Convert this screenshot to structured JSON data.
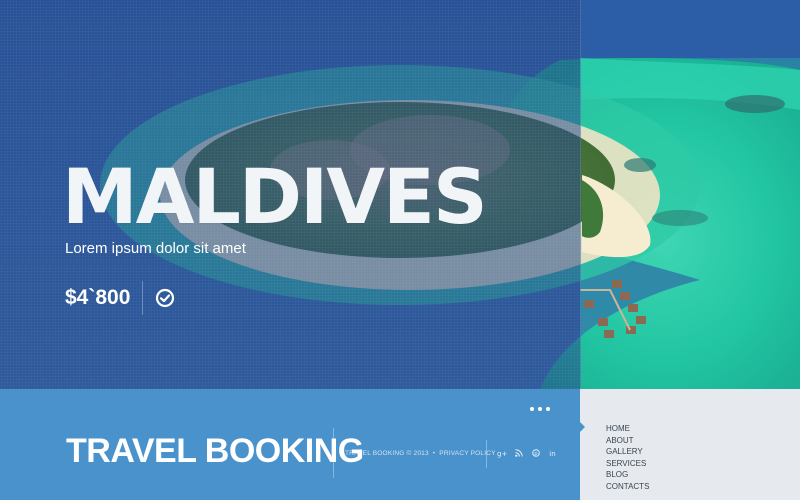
{
  "hero": {
    "title": "MALDIVES",
    "subtitle": "Lorem ipsum dolor sit amet",
    "price": "$4`800"
  },
  "footer": {
    "brand": "TRAVEL BOOKING",
    "copyright_prefix": "TRAVEL BOOKING © 2013",
    "copyright_sep": "•",
    "privacy_label": "PRIVACY POLICY",
    "social": [
      {
        "name": "google-plus-icon",
        "glyph": "g+"
      },
      {
        "name": "rss-icon",
        "glyph": "❡"
      },
      {
        "name": "pinterest-icon",
        "glyph": "℗"
      },
      {
        "name": "linkedin-icon",
        "glyph": "in"
      }
    ]
  },
  "nav": {
    "items": [
      "HOME",
      "ABOUT",
      "GALLERY",
      "SERVICES",
      "BLOG",
      "CONTACTS"
    ]
  },
  "colors": {
    "overlay": "#264c8c",
    "footer_blue": "#4a92cc",
    "nav_bg": "#e6eaee",
    "sea_turquoise": "#1fbf9a",
    "deep_sea": "#2c5da0"
  },
  "icons": {
    "price_action": "check-circle-icon",
    "more": "dots-icon"
  }
}
